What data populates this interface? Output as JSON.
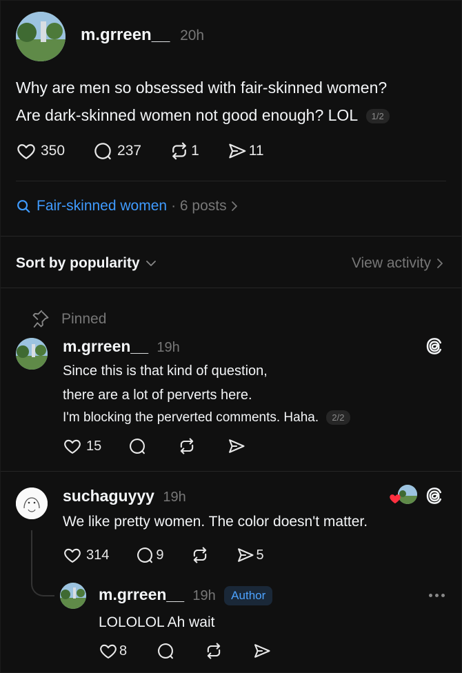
{
  "post": {
    "username": "m.grreen__",
    "time": "20h",
    "line1": "Why are men so obsessed with fair-skinned women?",
    "line2": "Are dark-skinned women not good enough? LOL",
    "pager": "1/2",
    "likes": "350",
    "replies": "237",
    "reposts": "1",
    "shares": "11"
  },
  "topic": {
    "label": "Fair-skinned women",
    "meta": "· 6 posts",
    "accent": "#3f9bff"
  },
  "sort": {
    "label": "Sort by popularity",
    "view_activity": "View activity"
  },
  "pinned_reply": {
    "pinned_label": "Pinned",
    "username": "m.grreen__",
    "time": "19h",
    "line1": "Since this is that kind of question,",
    "line2": "there are a lot of perverts here.",
    "line3": "I'm blocking the perverted comments. Haha.",
    "pager": "2/2",
    "likes": "15"
  },
  "reply2": {
    "username": "suchaguyyy",
    "time": "19h",
    "text": "We like pretty women. The color doesn't matter.",
    "likes": "314",
    "replies": "9",
    "shares": "5",
    "liked_heart_color": "#ff3040"
  },
  "nested_reply": {
    "username": "m.grreen__",
    "time": "19h",
    "badge": "Author",
    "text": "LOLOLOL Ah wait",
    "likes": "8"
  }
}
